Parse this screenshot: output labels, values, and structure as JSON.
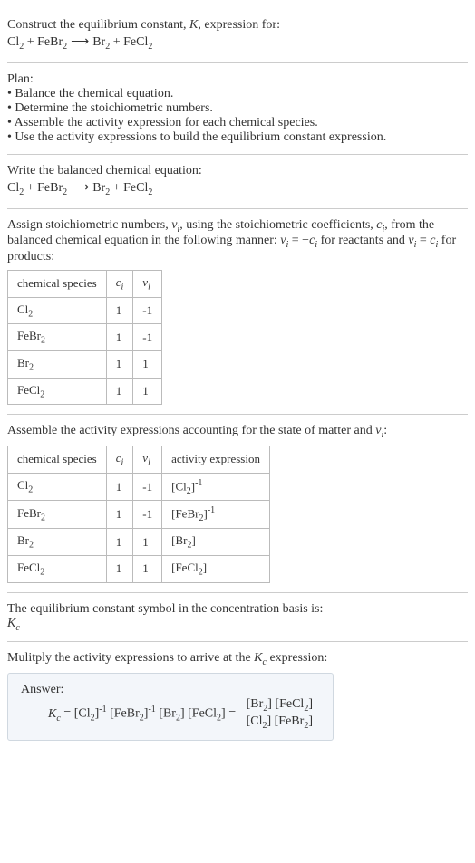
{
  "intro": {
    "line1": "Construct the equilibrium constant, K, expression for:",
    "equation": "Cl₂ + FeBr₂ ⟶ Br₂ + FeCl₂"
  },
  "plan": {
    "heading": "Plan:",
    "b1": "• Balance the chemical equation.",
    "b2": "• Determine the stoichiometric numbers.",
    "b3": "• Assemble the activity expression for each chemical species.",
    "b4": "• Use the activity expressions to build the equilibrium constant expression."
  },
  "balanced": {
    "heading": "Write the balanced chemical equation:",
    "equation": "Cl₂ + FeBr₂ ⟶ Br₂ + FeCl₂"
  },
  "stoich": {
    "text1": "Assign stoichiometric numbers, νᵢ, using the stoichiometric coefficients, cᵢ, from the balanced chemical equation in the following manner: νᵢ = −cᵢ for reactants and νᵢ = cᵢ for products:",
    "h1": "chemical species",
    "h2": "cᵢ",
    "h3": "νᵢ",
    "r1c1": "Cl₂",
    "r1c2": "1",
    "r1c3": "-1",
    "r2c1": "FeBr₂",
    "r2c2": "1",
    "r2c3": "-1",
    "r3c1": "Br₂",
    "r3c2": "1",
    "r3c3": "1",
    "r4c1": "FeCl₂",
    "r4c2": "1",
    "r4c3": "1"
  },
  "activity": {
    "heading": "Assemble the activity expressions accounting for the state of matter and νᵢ:",
    "h1": "chemical species",
    "h2": "cᵢ",
    "h3": "νᵢ",
    "h4": "activity expression",
    "r1c1": "Cl₂",
    "r1c2": "1",
    "r1c3": "-1",
    "r1c4": "[Cl₂]⁻¹",
    "r2c1": "FeBr₂",
    "r2c2": "1",
    "r2c3": "-1",
    "r2c4": "[FeBr₂]⁻¹",
    "r3c1": "Br₂",
    "r3c2": "1",
    "r3c3": "1",
    "r3c4": "[Br₂]",
    "r4c1": "FeCl₂",
    "r4c2": "1",
    "r4c3": "1",
    "r4c4": "[FeCl₂]"
  },
  "kc_symbol": {
    "line1": "The equilibrium constant symbol in the concentration basis is:",
    "line2": "K_c"
  },
  "final": {
    "heading": "Mulitply the activity expressions to arrive at the K_c expression:",
    "answer_label": "Answer:",
    "kc": "K_c",
    "eq": " = [Cl₂]⁻¹ [FeBr₂]⁻¹ [Br₂] [FeCl₂] = ",
    "num": "[Br₂] [FeCl₂]",
    "den": "[Cl₂] [FeBr₂]"
  }
}
